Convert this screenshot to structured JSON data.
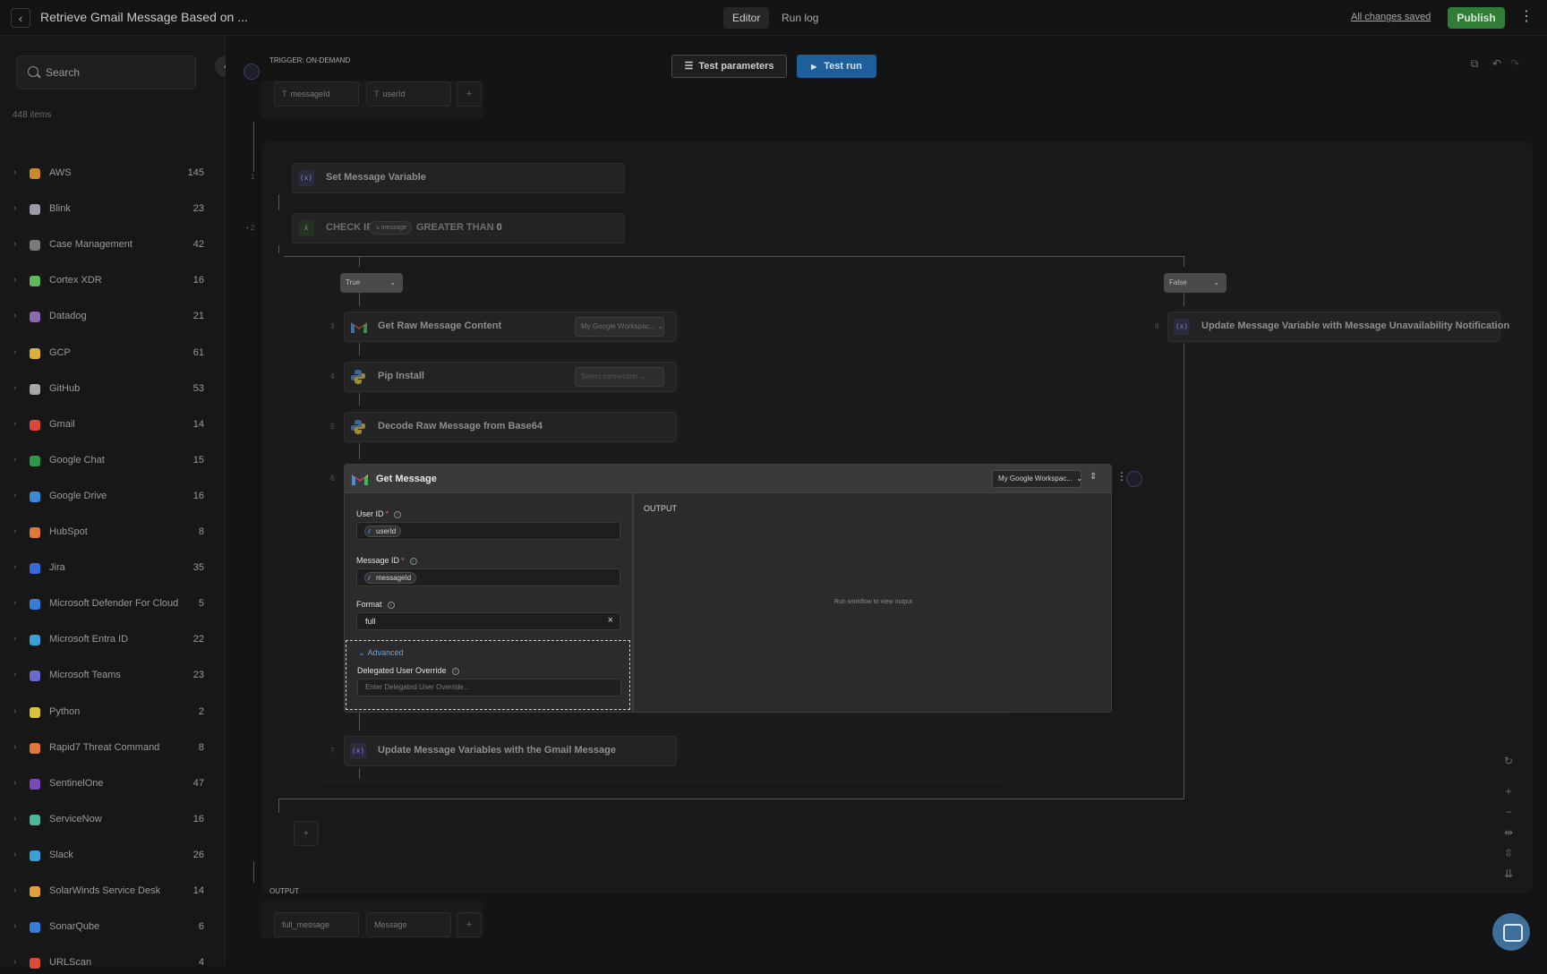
{
  "header": {
    "title": "Retrieve Gmail Message Based on ...",
    "tabs": [
      "Editor",
      "Run log"
    ],
    "saved_status": "All changes saved",
    "publish_label": "Publish"
  },
  "sidebar": {
    "search_placeholder": "Search",
    "items_count": "448 items",
    "categories": [
      {
        "name": "AWS",
        "count": "145",
        "color": "#c98a2e"
      },
      {
        "name": "Blink",
        "count": "23",
        "color": "#9a9aa8"
      },
      {
        "name": "Case Management",
        "count": "42",
        "color": "#7a7a7a"
      },
      {
        "name": "Cortex XDR",
        "count": "16",
        "color": "#5eb85e"
      },
      {
        "name": "Datadog",
        "count": "21",
        "color": "#8a6ab0"
      },
      {
        "name": "GCP",
        "count": "61",
        "color": "#d8b23a"
      },
      {
        "name": "GitHub",
        "count": "53",
        "color": "#a8a8a8"
      },
      {
        "name": "Gmail",
        "count": "14",
        "color": "#d9483a"
      },
      {
        "name": "Google Chat",
        "count": "15",
        "color": "#2a9a4a"
      },
      {
        "name": "Google Drive",
        "count": "16",
        "color": "#3a8ad8"
      },
      {
        "name": "HubSpot",
        "count": "8",
        "color": "#e0783a"
      },
      {
        "name": "Jira",
        "count": "35",
        "color": "#3a6ad8"
      },
      {
        "name": "Microsoft Defender For Cloud",
        "count": "5",
        "color": "#3a7ad8"
      },
      {
        "name": "Microsoft Entra ID",
        "count": "22",
        "color": "#3aa0d8"
      },
      {
        "name": "Microsoft Teams",
        "count": "23",
        "color": "#6a6ad0"
      },
      {
        "name": "Python",
        "count": "2",
        "color": "#d8c23a"
      },
      {
        "name": "Rapid7 Threat Command",
        "count": "8",
        "color": "#e0783a"
      },
      {
        "name": "SentinelOne",
        "count": "47",
        "color": "#7a4ab8"
      },
      {
        "name": "ServiceNow",
        "count": "16",
        "color": "#4ab89a"
      },
      {
        "name": "Slack",
        "count": "26",
        "color": "#3aa0d8"
      },
      {
        "name": "SolarWinds Service Desk",
        "count": "14",
        "color": "#e0a03a"
      },
      {
        "name": "SonarQube",
        "count": "6",
        "color": "#3a7ad8"
      },
      {
        "name": "URLScan",
        "count": "4",
        "color": "#d84a3a"
      }
    ]
  },
  "canvas": {
    "trigger_label": "TRIGGER: ON-DEMAND",
    "trigger_params": [
      "messageId",
      "userId"
    ],
    "test_params_label": "Test parameters",
    "test_run_label": "Test run",
    "steps": {
      "s1": {
        "num": "1",
        "label": "Set Message Variable"
      },
      "s2": {
        "num": "2",
        "check_if": "CHECK IF",
        "var": "message",
        "op": "GREATER THAN",
        "value": "0"
      },
      "s3": {
        "num": "3",
        "label": "Get Raw Message Content",
        "connection": "My Google Workspac..."
      },
      "s4": {
        "num": "4",
        "label": "Pip Install",
        "connection": "Select connection"
      },
      "s5": {
        "num": "5",
        "label": "Decode Raw Message from Base64"
      },
      "s6": {
        "num": "6"
      },
      "s7": {
        "num": "7",
        "label": "Update Message Variables with the Gmail Message"
      },
      "s8": {
        "num": "8",
        "label": "Update Message Variable with Message Unavailability Notification"
      }
    },
    "branch_true": "True",
    "branch_false": "False",
    "output_label": "OUTPUT",
    "output_params": [
      "full_message",
      "Message"
    ]
  },
  "get_message": {
    "title": "Get Message",
    "connection": "My Google Workspac...",
    "user_id_label": "User ID",
    "user_id_value": "userId",
    "message_id_label": "Message ID",
    "message_id_value": "messageId",
    "format_label": "Format",
    "format_value": "full",
    "advanced_label": "Advanced",
    "delegated_label": "Delegated User Override",
    "delegated_placeholder": "Enter Delegated User Override...",
    "output_label": "OUTPUT",
    "output_hint": "Run workflow to view output"
  }
}
